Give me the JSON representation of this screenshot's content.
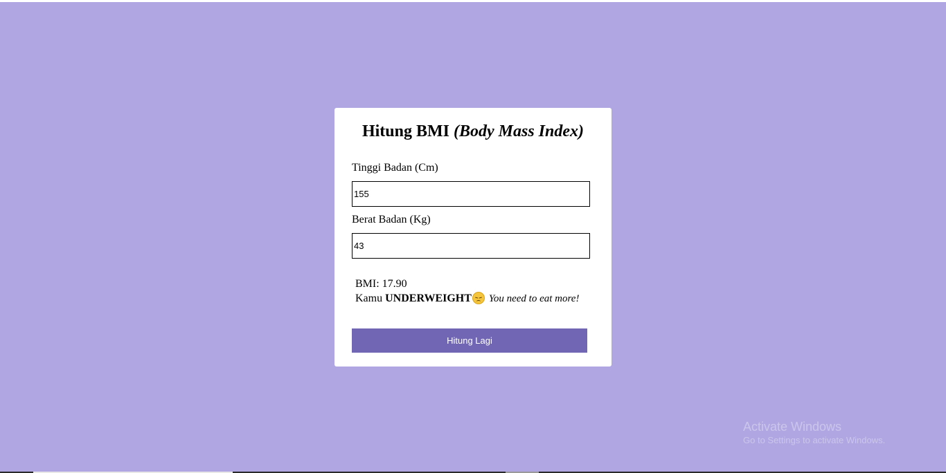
{
  "page": {
    "background": "#b0a7e2",
    "accent": "#7066b3"
  },
  "card": {
    "title_main": "Hitung BMI",
    "title_italic": "(Body Mass Index)",
    "height_label": "Tinggi Badan (Cm)",
    "height_value": "155",
    "weight_label": "Berat Badan (Kg)",
    "weight_value": "43",
    "result": {
      "bmi_text": "BMI: 17.90",
      "prefix": "Kamu",
      "category": "UNDERWEIGHT",
      "emoji": "disappointed-face-icon",
      "advice": "You need to eat more!"
    },
    "button_label": "Hitung Lagi"
  },
  "watermark": {
    "title": "Activate Windows",
    "subtitle": "Go to Settings to activate Windows."
  }
}
